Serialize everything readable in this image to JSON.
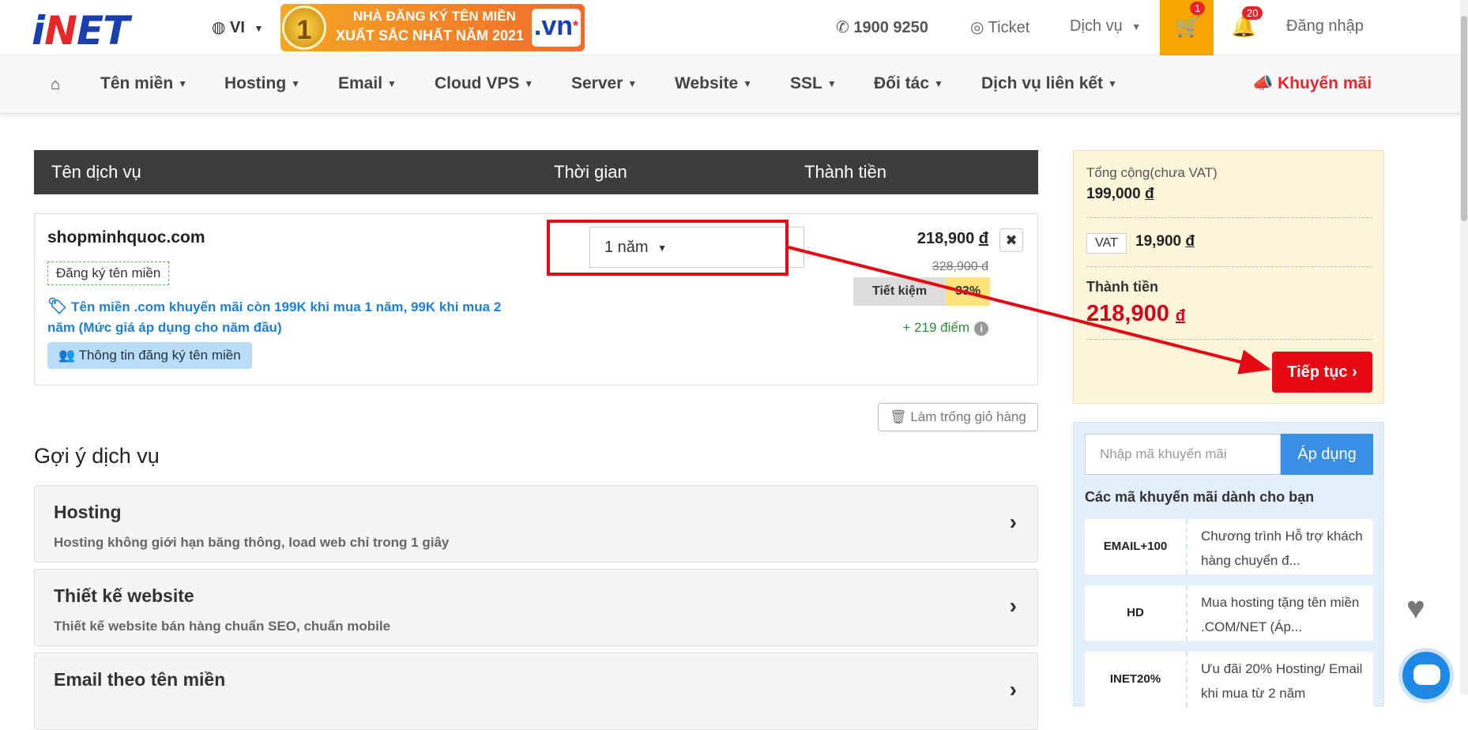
{
  "header": {
    "logo_prefix": "i",
    "logo_e": "N",
    "logo_rest": "ET",
    "language": "VI",
    "banner_rank": "1",
    "banner_line1": "NHÀ ĐĂNG KÝ TÊN MIỀN",
    "banner_line2": "XUẤT SẮC NHẤT NĂM 2021",
    "banner_vn": ".vn",
    "hotline": "1900 9250",
    "ticket": "Ticket",
    "services": "Dịch vụ",
    "cart_count": "1",
    "notification_count": "20",
    "login": "Đăng nhập"
  },
  "nav": {
    "items": [
      "Tên miền",
      "Hosting",
      "Email",
      "Cloud VPS",
      "Server",
      "Website",
      "SSL",
      "Đối tác",
      "Dịch vụ liên kết"
    ],
    "promo": "Khuyến mãi"
  },
  "cart": {
    "columns": [
      "Tên dịch vụ",
      "Thời gian",
      "Thành tiền"
    ],
    "item": {
      "domain": "shopminhquoc.com",
      "type_tag": "Đăng ký tên miền",
      "promo_note": "Tên miền .com khuyến mãi còn 199K khi mua 1 năm, 99K khi mua 2 năm (Mức giá áp dụng cho năm đầu)",
      "info_button": "Thông tin đăng ký tên miền",
      "period": "1 năm",
      "price": "218,900",
      "old_price": "328,900",
      "save_label": "Tiết kiệm",
      "save_percent": "33%",
      "points": "+ 219 điểm",
      "currency": "đ"
    },
    "clear_button": "Làm trống giỏ hàng"
  },
  "suggestions": {
    "title": "Gợi ý dịch vụ",
    "items": [
      {
        "title": "Hosting",
        "desc": "Hosting không giới hạn băng thông, load web chỉ trong 1 giây"
      },
      {
        "title": "Thiết kế website",
        "desc": "Thiết kế website bán hàng chuẩn SEO, chuẩn mobile"
      },
      {
        "title": "Email theo tên miền",
        "desc": ""
      }
    ]
  },
  "summary": {
    "subtotal_label": "Tổng cộng(chưa VAT)",
    "subtotal": "199,000",
    "vat_label": "VAT",
    "vat": "19,900",
    "total_label": "Thành tiền",
    "total": "218,900",
    "currency": "đ",
    "continue_button": "Tiếp tục"
  },
  "coupons": {
    "placeholder": "Nhập mã khuyến mãi",
    "apply_button": "Áp dụng",
    "heading": "Các mã khuyến mãi dành cho bạn",
    "items": [
      {
        "code": "EMAIL+100",
        "desc": "Chương trình Hỗ trợ khách hàng chuyển đ..."
      },
      {
        "code": "HD",
        "desc": "Mua hosting tặng tên miền .COM/NET (Áp..."
      },
      {
        "code": "INET20%",
        "desc": "Ưu đãi 20% Hosting/ Email khi mua từ 2 năm"
      }
    ]
  },
  "colors": {
    "brand_blue": "#1a3fae",
    "brand_red": "#e7262a",
    "cart_orange": "#f5a400",
    "annotation_red": "#e50914"
  }
}
